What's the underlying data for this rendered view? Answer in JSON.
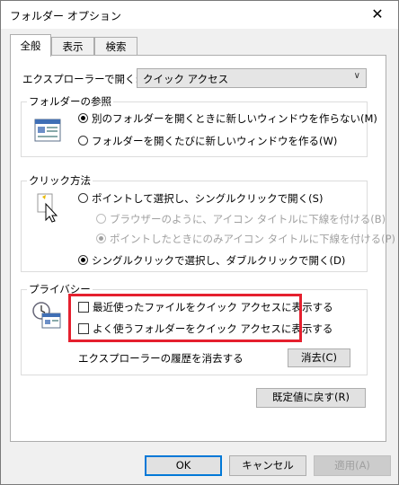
{
  "window": {
    "title": "フォルダー オプション",
    "close_glyph": "✕"
  },
  "tabs": [
    {
      "label": "全般",
      "active": true
    },
    {
      "label": "表示",
      "active": false
    },
    {
      "label": "検索",
      "active": false
    }
  ],
  "general": {
    "open_explorer_label": "エクスプローラーで開く:",
    "open_explorer_value": "クイック アクセス",
    "folder_browse": {
      "title": "フォルダーの参照",
      "options": [
        {
          "label": "別のフォルダーを開くときに新しいウィンドウを作らない(M)",
          "checked": true
        },
        {
          "label": "フォルダーを開くたびに新しいウィンドウを作る(W)",
          "checked": false
        }
      ]
    },
    "click_method": {
      "title": "クリック方法",
      "options": [
        {
          "label": "ポイントして選択し、シングルクリックで開く(S)",
          "checked": false,
          "disabled": false
        },
        {
          "label": "ブラウザーのように、アイコン タイトルに下線を付ける(B)",
          "checked": false,
          "disabled": true
        },
        {
          "label": "ポイントしたときにのみアイコン タイトルに下線を付ける(P)",
          "checked": true,
          "disabled": true
        },
        {
          "label": "シングルクリックで選択し、ダブルクリックで開く(D)",
          "checked": true,
          "disabled": false
        }
      ]
    },
    "privacy": {
      "title": "プライバシー",
      "checkboxes": [
        {
          "label": "最近使ったファイルをクイック アクセスに表示する",
          "checked": false
        },
        {
          "label": "よく使うフォルダーをクイック アクセスに表示する",
          "checked": false
        }
      ],
      "clear_history_label": "エクスプローラーの履歴を消去する",
      "clear_button": "消去(C)"
    },
    "restore_defaults_button": "既定値に戻す(R)"
  },
  "footer": {
    "ok": "OK",
    "cancel": "キャンセル",
    "apply": "適用(A)"
  },
  "colors": {
    "highlight_border": "#e5202e",
    "default_button_border": "#0078d7"
  }
}
